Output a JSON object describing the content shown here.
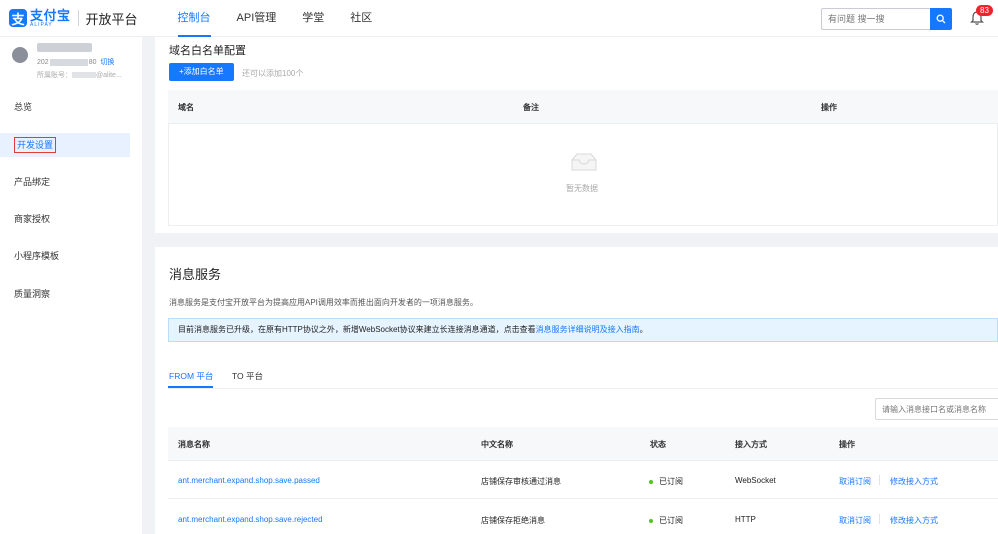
{
  "header": {
    "logo_cn": "支付宝",
    "logo_en": "ALIPAY",
    "platform": "开放平台",
    "nav": [
      "控制台",
      "API管理",
      "学堂",
      "社区"
    ],
    "active_nav_index": 0,
    "search_placeholder": "有问题 搜一搜",
    "notification_count": "83"
  },
  "sidebar": {
    "user": {
      "id_prefix": "202",
      "id_suffix": "80",
      "switch_label": "切换",
      "account_prefix": "所属账号：",
      "account_suffix": "@alite..."
    },
    "items": [
      "总览",
      "开发设置",
      "产品绑定",
      "商家授权",
      "小程序模板",
      "质量洞察"
    ],
    "active_index": 1
  },
  "whitelist": {
    "title": "域名白名单配置",
    "add_button": "+添加白名单",
    "limit_tip": "还可以添加100个",
    "columns": [
      "域名",
      "备注",
      "操作"
    ],
    "empty_text": "暂无数据"
  },
  "message_service": {
    "title": "消息服务",
    "description": "消息服务是支付宝开放平台为提高应用API调用效率而推出面向开发者的一项消息服务。",
    "notice_text": "目前消息服务已升级，在原有HTTP协议之外，新增WebSocket协议来建立长连接消息通道，点击查看",
    "notice_link": "消息服务详细说明及接入指南",
    "notice_end": "。",
    "tabs": [
      "FROM 平台",
      "TO 平台"
    ],
    "active_tab_index": 0,
    "filter_placeholder": "请输入消息接口名或消息名称",
    "columns": [
      "消息名称",
      "中文名称",
      "状态",
      "接入方式",
      "操作"
    ],
    "rows": [
      {
        "name": "ant.merchant.expand.shop.save.passed",
        "cn_name": "店铺保存审核通过消息",
        "status": "已订阅",
        "method": "WebSocket",
        "actions": [
          "取消订阅",
          "修改接入方式"
        ]
      },
      {
        "name": "ant.merchant.expand.shop.save.rejected",
        "cn_name": "店铺保存拒绝消息",
        "status": "已订阅",
        "method": "HTTP",
        "actions": [
          "取消订阅",
          "修改接入方式"
        ]
      }
    ]
  },
  "colors": {
    "primary": "#1677ff",
    "success": "#52c41a",
    "highlight_border": "#e23b3b"
  }
}
